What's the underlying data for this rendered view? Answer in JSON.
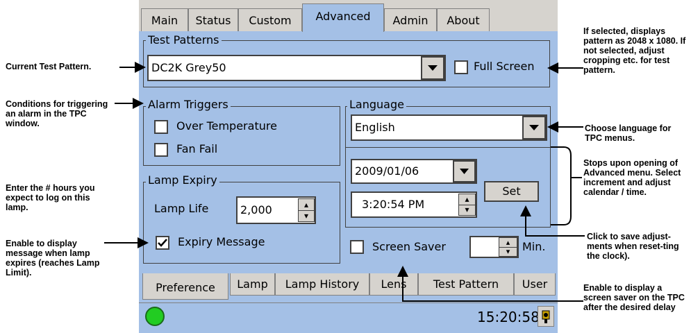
{
  "top_tabs": [
    "Main",
    "Status",
    "Custom",
    "Advanced",
    "Admin",
    "About"
  ],
  "test_patterns": {
    "legend": "Test Patterns",
    "selected": "DC2K Grey50",
    "full_screen_label": "Full Screen",
    "full_screen_checked": false
  },
  "alarm_triggers": {
    "legend": "Alarm Triggers",
    "over_temp_label": "Over Temperature",
    "fan_fail_label": "Fan Fail"
  },
  "language": {
    "legend": "Language",
    "selected": "English"
  },
  "datetime": {
    "date": "2009/01/06",
    "time": "3:20:54 PM",
    "set_label": "Set"
  },
  "lamp_expiry": {
    "legend": "Lamp Expiry",
    "lamp_life_label": "Lamp Life",
    "lamp_life_value": "2,000",
    "expiry_message_label": "Expiry Message",
    "expiry_message_checked": true
  },
  "screen_saver": {
    "label": "Screen Saver",
    "minutes_value": "",
    "unit": "Min."
  },
  "bottom_tabs": [
    "Preference",
    "Lamp",
    "Lamp History",
    "Lens",
    "Test Pattern",
    "User"
  ],
  "status_bar": {
    "clock": "15:20:58",
    "status_color": "#22cc22"
  },
  "annotations": {
    "current_pattern": "Current Test Pattern.",
    "conditions": "Conditions for triggering an alarm in the TPC window.",
    "enter_hours": "Enter the # hours you expect to log on this lamp.",
    "enable_display": "Enable to display message when lamp expires (reaches Lamp Limit).",
    "full_screen_note": "If selected, displays pattern as 2048 x 1080. If not selected, adjust cropping etc. for test pattern.",
    "choose_language": "Choose language for TPC menus.",
    "stops_upon": "Stops upon opening of Advanced menu. Select increment and adjust calendar / time.",
    "click_save": "Click to save adjust-ments when reset-ting the clock).",
    "screen_saver_note": "Enable to display a screen saver on the TPC after the desired delay"
  }
}
